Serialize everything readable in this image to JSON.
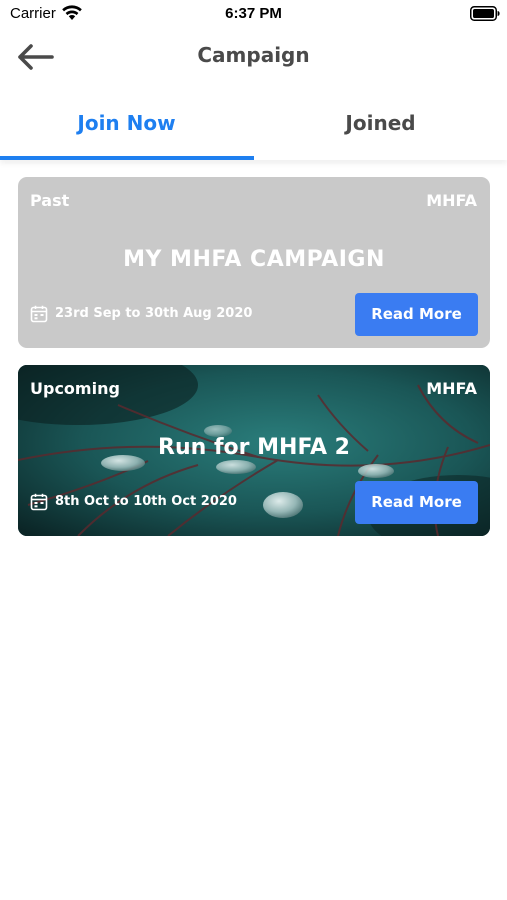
{
  "status_bar": {
    "carrier": "Carrier",
    "time": "6:37 PM"
  },
  "header": {
    "title": "Campaign",
    "back_icon": "arrow-left-icon"
  },
  "tabs": [
    {
      "label": "Join Now",
      "active": true
    },
    {
      "label": "Joined",
      "active": false
    }
  ],
  "colors": {
    "accent": "#1e7ff0",
    "button": "#3a7cf2",
    "past_card": "#c9c9c9",
    "text_dark": "#4a4a4a"
  },
  "campaigns": [
    {
      "status": "Past",
      "org": "MHFA",
      "title": "MY MHFA CAMPAIGN",
      "date_range": "23rd Sep to 30th Aug 2020",
      "button_label": "Read More"
    },
    {
      "status": "Upcoming",
      "org": "MHFA",
      "title": "Run for MHFA 2",
      "date_range": "8th Oct to 10th Oct 2020",
      "button_label": "Read More"
    }
  ]
}
